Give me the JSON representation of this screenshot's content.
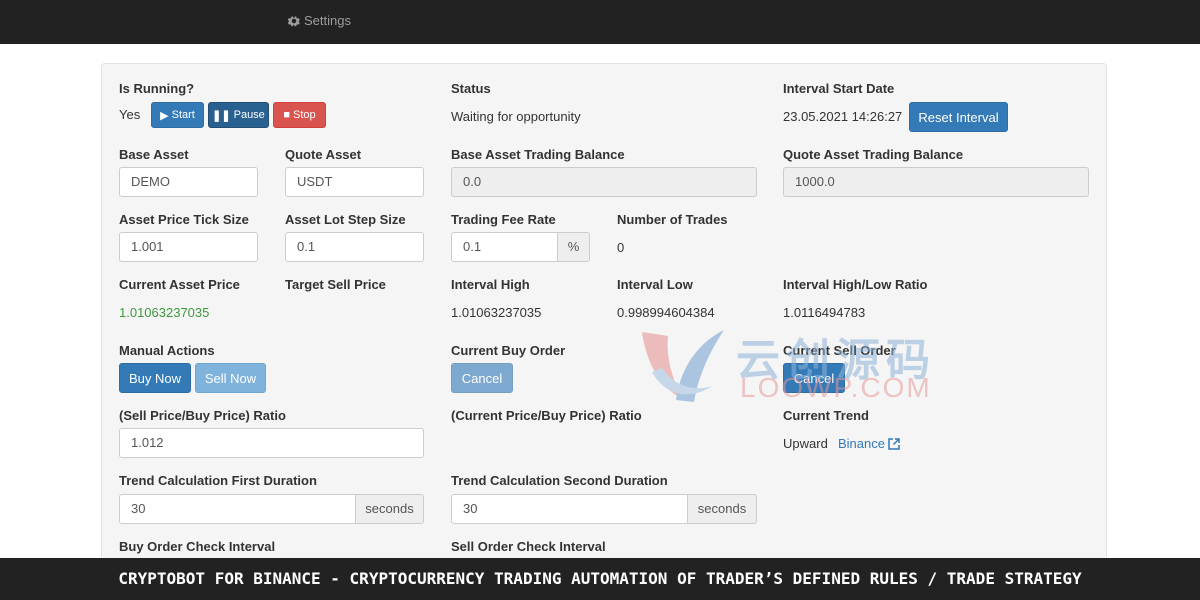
{
  "nav": {
    "settings_label": "Settings"
  },
  "running": {
    "label": "Is Running?",
    "value": "Yes",
    "start_label": "Start",
    "pause_label": "Pause",
    "stop_label": "Stop"
  },
  "status": {
    "label": "Status",
    "value": "Waiting for opportunity"
  },
  "interval_start": {
    "label": "Interval Start Date",
    "value": "23.05.2021 14:26:27",
    "reset_label": "Reset Interval"
  },
  "base_asset": {
    "label": "Base Asset",
    "value": "DEMO"
  },
  "quote_asset": {
    "label": "Quote Asset",
    "value": "USDT"
  },
  "base_balance": {
    "label": "Base Asset Trading Balance",
    "value": "0.0"
  },
  "quote_balance": {
    "label": "Quote Asset Trading Balance",
    "value": "1000.0"
  },
  "tick_size": {
    "label": "Asset Price Tick Size",
    "value": "1.001"
  },
  "lot_step": {
    "label": "Asset Lot Step Size",
    "value": "0.1"
  },
  "fee_rate": {
    "label": "Trading Fee Rate",
    "value": "0.1",
    "unit": "%"
  },
  "num_trades": {
    "label": "Number of Trades",
    "value": "0"
  },
  "current_price": {
    "label": "Current Asset Price",
    "value": "1.01063237035",
    "color": "#3c9a3c"
  },
  "target_sell": {
    "label": "Target Sell Price"
  },
  "interval_high": {
    "label": "Interval High",
    "value": "1.01063237035"
  },
  "interval_low": {
    "label": "Interval Low",
    "value": "0.998994604384"
  },
  "high_low_ratio": {
    "label": "Interval High/Low Ratio",
    "value": "1.0116494783"
  },
  "manual_actions": {
    "label": "Manual Actions",
    "buy_label": "Buy Now",
    "sell_label": "Sell Now"
  },
  "buy_order": {
    "label": "Current Buy Order",
    "cancel_label": "Cancel"
  },
  "sell_order": {
    "label": "Current Sell Order",
    "cancel_label": "Cancel"
  },
  "sell_buy_ratio": {
    "label": "(Sell Price/Buy Price) Ratio",
    "value": "1.012"
  },
  "current_buy_ratio": {
    "label": "(Current Price/Buy Price) Ratio"
  },
  "trend": {
    "label": "Current Trend",
    "value": "Upward",
    "link_label": "Binance"
  },
  "trend_first": {
    "label": "Trend Calculation First Duration",
    "value": "30",
    "unit": "seconds"
  },
  "trend_second": {
    "label": "Trend Calculation Second Duration",
    "value": "30",
    "unit": "seconds"
  },
  "buy_check": {
    "label": "Buy Order Check Interval"
  },
  "sell_check": {
    "label": "Sell Order Check Interval"
  },
  "watermark": {
    "cn": "云创源码",
    "en": "LOOWP.COM"
  },
  "caption": "CRYPTOBOT FOR BINANCE - CRYPTOCURRENCY TRADING AUTOMATION OF TRADER’S DEFINED RULES / TRADE STRATEGY",
  "colors": {
    "primary": "#337ab7",
    "danger": "#d9534f",
    "nav_bg": "#222222",
    "panel_bg": "#f5f5f5"
  },
  "icons": [
    "gear-icon",
    "play-icon",
    "pause-icon",
    "stop-icon",
    "external-link-icon"
  ]
}
